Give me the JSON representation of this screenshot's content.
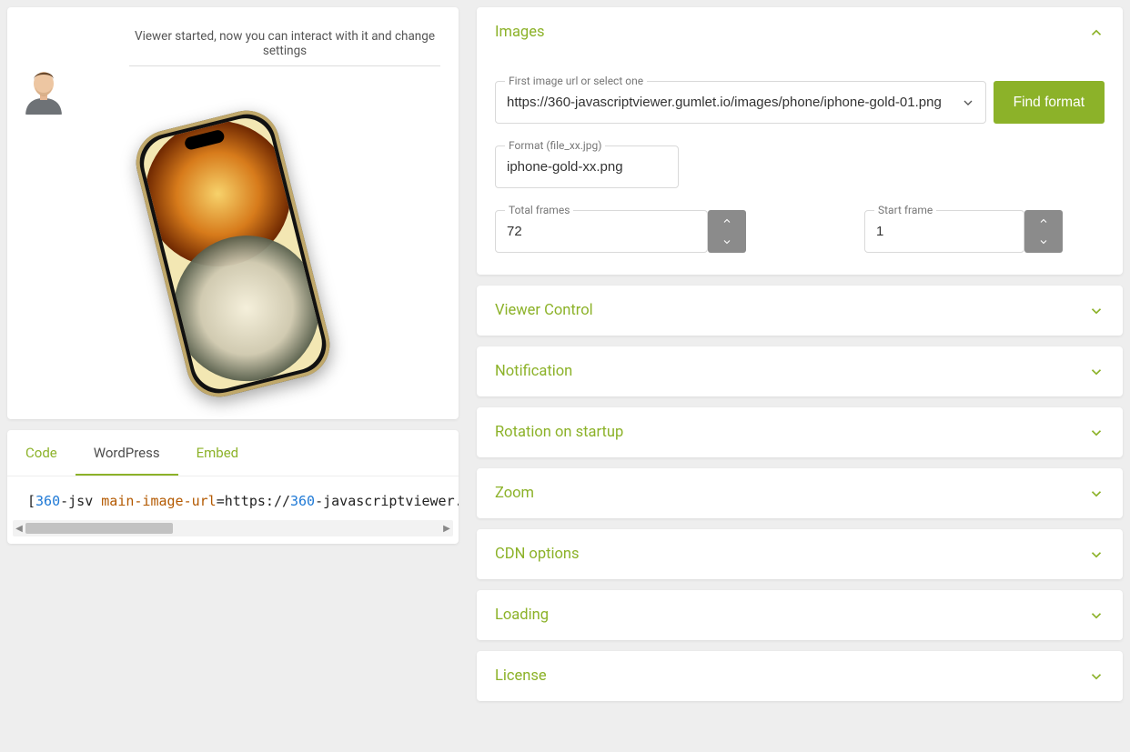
{
  "viewer": {
    "message": "Viewer started, now you can interact with it and change settings"
  },
  "tabs": {
    "code": "Code",
    "wordpress": "WordPress",
    "embed": "Embed"
  },
  "code": {
    "open_br": "[",
    "n360": "360",
    "dash_jsv": "-jsv ",
    "attr": "main-image-url",
    "eq": "=",
    "url1": "https:",
    "url2": "//",
    "url3": "360",
    "url4": "-javascriptviewer.g"
  },
  "settings": {
    "images": {
      "title": "Images",
      "first_image_label": "First image url or select one",
      "first_image_value": "https://360-javascriptviewer.gumlet.io/images/phone/iphone-gold-01.png",
      "find_format": "Find format",
      "format_label": "Format (file_xx.jpg)",
      "format_value": "iphone-gold-xx.png",
      "total_frames_label": "Total frames",
      "total_frames_value": "72",
      "start_frame_label": "Start frame",
      "start_frame_value": "1"
    },
    "sections": {
      "viewer_control": "Viewer Control",
      "notification": "Notification",
      "rotation": "Rotation on startup",
      "zoom": "Zoom",
      "cdn": "CDN options",
      "loading": "Loading",
      "license": "License"
    }
  }
}
